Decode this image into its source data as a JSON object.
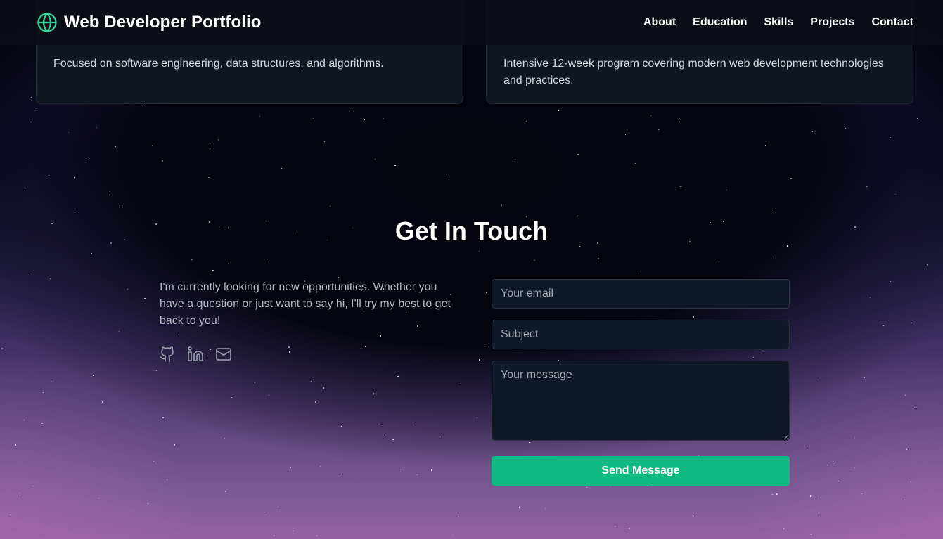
{
  "header": {
    "title": "Web Developer Portfolio",
    "logo_icon": "globe-icon",
    "accent": "#34d399",
    "nav": [
      {
        "label": "About"
      },
      {
        "label": "Education"
      },
      {
        "label": "Skills"
      },
      {
        "label": "Projects"
      },
      {
        "label": "Contact"
      }
    ]
  },
  "education": {
    "cards": [
      {
        "description": "Focused on software engineering, data structures, and algorithms."
      },
      {
        "description": "Intensive 12-week program covering modern web development technologies and practices."
      }
    ]
  },
  "contact": {
    "title": "Get In Touch",
    "text": "I'm currently looking for new opportunities. Whether you have a question or just want to say hi, I'll try my best to get back to you!",
    "socials": [
      {
        "icon": "github-icon"
      },
      {
        "icon": "linkedin-icon"
      },
      {
        "icon": "mail-icon"
      }
    ],
    "form": {
      "email_placeholder": "Your email",
      "subject_placeholder": "Subject",
      "message_placeholder": "Your message",
      "submit_label": "Send Message",
      "button_color": "#10b981"
    }
  }
}
